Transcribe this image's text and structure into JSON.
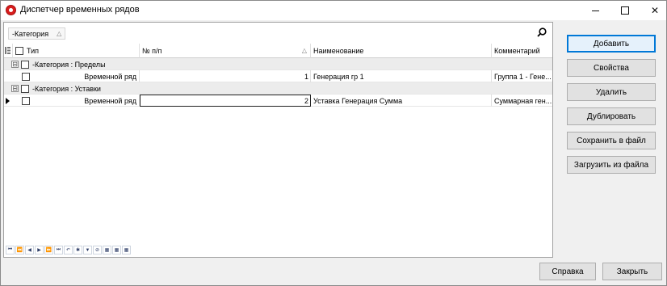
{
  "window": {
    "title": "Диспетчер временных рядов"
  },
  "groupbar": {
    "chip_label": "-Категория",
    "chip_sort": "△"
  },
  "columns": {
    "type": "Тип",
    "num": "№ п/п",
    "num_sort": "△",
    "name": "Наименование",
    "comment": "Комментарий"
  },
  "groups": [
    {
      "label": "-Категория : Пределы",
      "expander": "⊟",
      "row": {
        "type": "Временной ряд",
        "num": "1",
        "name": "Генерация гр 1",
        "comment": "Группа 1 - Гене..."
      }
    },
    {
      "label": "-Категория : Уставки",
      "expander": "⊟",
      "row": {
        "type": "Временной ряд",
        "num": "2",
        "name": "Уставка Генерация Сумма",
        "comment": "Суммарная ген..."
      }
    }
  ],
  "side_buttons": {
    "add": "Добавить",
    "props": "Свойства",
    "delete": "Удалить",
    "duplicate": "Дублировать",
    "save": "Сохранить в файл",
    "load": "Загрузить из файла"
  },
  "footer": {
    "help": "Справка",
    "close": "Закрыть"
  },
  "nav": [
    "⏮",
    "⏪",
    "◀",
    "▶",
    "⏩",
    "⏭",
    "↶",
    "✱",
    "▼",
    "⊘",
    "▦",
    "▦",
    "▦"
  ]
}
